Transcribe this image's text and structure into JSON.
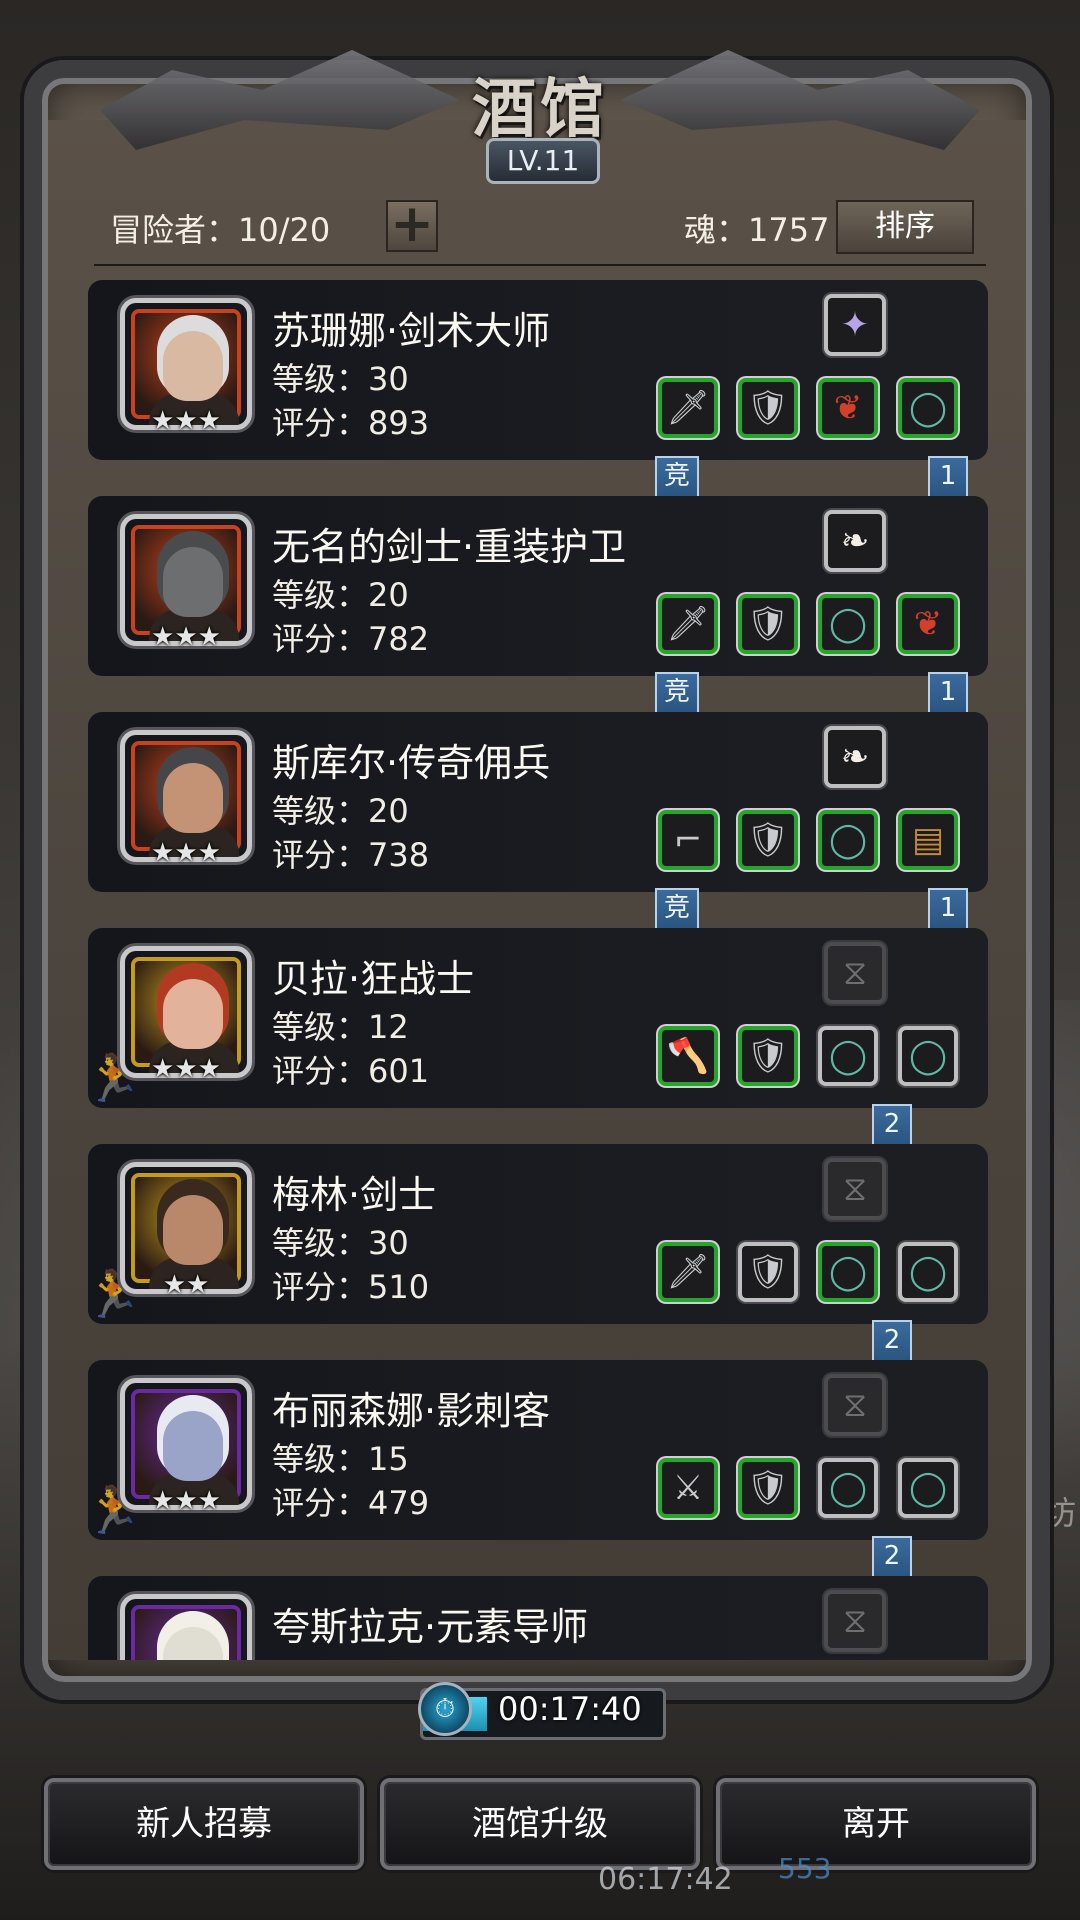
{
  "header": {
    "title": "酒馆",
    "level": "LV.11",
    "adventurers_label": "冒险者：10/20",
    "soul_label": "魂：1757",
    "sort_label": "排序",
    "add_label": "+"
  },
  "heroes": [
    {
      "name": "苏珊娜·剑术大师",
      "level": "等级：30",
      "score": "评分：893",
      "stars": "★★★",
      "frame": "red",
      "skin": "#d9b9a2",
      "hair": "#dcdcdc",
      "top_item": "crystal",
      "items": [
        "sword",
        "armor",
        "cape",
        "ring"
      ],
      "ribbon_left": "竞",
      "ribbon_right": "1",
      "idle": false
    },
    {
      "name": "无名的剑士·重装护卫",
      "level": "等级：20",
      "score": "评分：782",
      "stars": "★★★",
      "frame": "red",
      "skin": "#6d6e70",
      "hair": "#4a4b4d",
      "top_item": "feather",
      "items": [
        "sword",
        "armor",
        "ring",
        "cape"
      ],
      "ribbon_left": "竞",
      "ribbon_right": "1",
      "idle": false
    },
    {
      "name": "斯库尔·传奇佣兵",
      "level": "等级：20",
      "score": "评分：738",
      "stars": "★★★",
      "frame": "red",
      "skin": "#c49274",
      "hair": "#454649",
      "top_item": "feather",
      "items": [
        "pistol",
        "armor",
        "ring",
        "barrel"
      ],
      "ribbon_left": "竞",
      "ribbon_right": "1",
      "idle": false
    },
    {
      "name": "贝拉·狂战士",
      "level": "等级：12",
      "score": "评分：601",
      "stars": "★★★",
      "frame": "gold",
      "skin": "#e2b29a",
      "hair": "#b33a22",
      "top_item": "empty",
      "items": [
        "axe",
        "armor",
        "ring",
        "ring"
      ],
      "ribbon_left": "",
      "ribbon_right": "2",
      "idle": true
    },
    {
      "name": "梅林·剑士",
      "level": "等级：30",
      "score": "评分：510",
      "stars": "★★",
      "frame": "gold",
      "skin": "#b9876a",
      "hair": "#3a2a1e",
      "top_item": "empty",
      "items": [
        "sword",
        "armor",
        "ring",
        "ring"
      ],
      "ribbon_left": "",
      "ribbon_right": "2",
      "idle": true
    },
    {
      "name": "布丽森娜·影刺客",
      "level": "等级：15",
      "score": "评分：479",
      "stars": "★★★",
      "frame": "purple",
      "skin": "#9aa3c8",
      "hair": "#e8eaf2",
      "top_item": "empty",
      "items": [
        "dagger",
        "armor",
        "ring",
        "ring"
      ],
      "ribbon_left": "",
      "ribbon_right": "2",
      "idle": true
    },
    {
      "name": "夸斯拉克·元素导师",
      "level": "",
      "score": "",
      "stars": "",
      "frame": "purple",
      "skin": "#e0ddd2",
      "hair": "#f1efe8",
      "top_item": "empty",
      "items": [],
      "ribbon_left": "",
      "ribbon_right": "",
      "idle": false
    }
  ],
  "timer": {
    "value": "00:17:40",
    "progress": 0.27
  },
  "buttons": {
    "recruit": "新人招募",
    "upgrade": "酒馆升级",
    "leave": "离开"
  },
  "background": {
    "clock": "06:17:42",
    "side_char": "坊",
    "count": "553"
  },
  "colors": {
    "frame_red": "#c7421d",
    "frame_gold": "#c49b1a",
    "frame_purple": "#6b2aa3",
    "slot_green": "#25a52a",
    "ribbon_blue": "#2f5e8c"
  }
}
